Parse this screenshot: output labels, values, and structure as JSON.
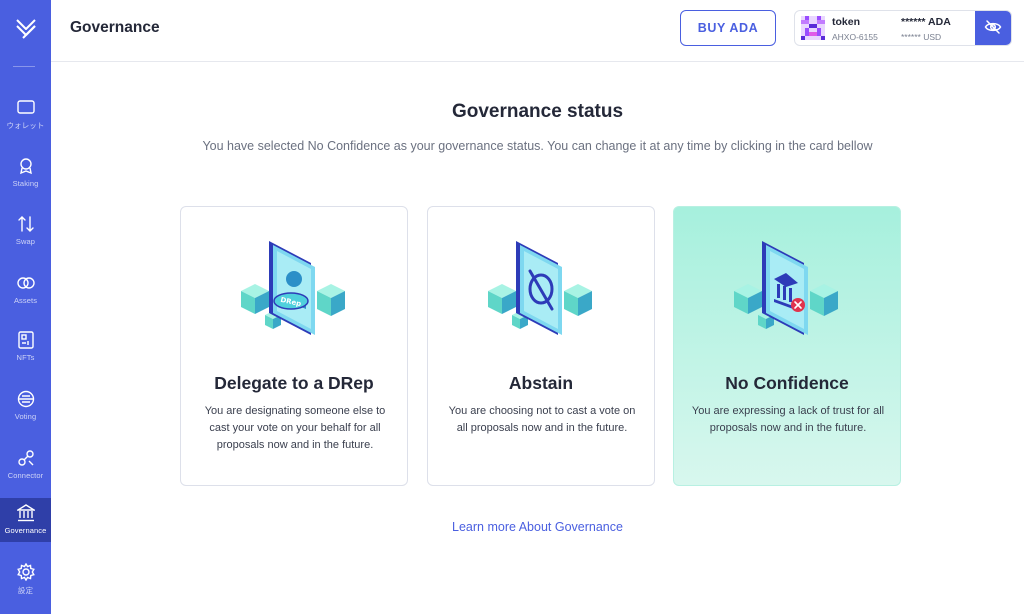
{
  "sidebar": {
    "items": [
      {
        "label": "ウォレット",
        "icon": "wallet-icon"
      },
      {
        "label": "Staking",
        "icon": "staking-icon"
      },
      {
        "label": "Swap",
        "icon": "swap-icon"
      },
      {
        "label": "Assets",
        "icon": "assets-icon"
      },
      {
        "label": "NFTs",
        "icon": "nfts-icon"
      },
      {
        "label": "Voting",
        "icon": "voting-icon"
      },
      {
        "label": "Connector",
        "icon": "connector-icon"
      },
      {
        "label": "Governance",
        "icon": "governance-icon",
        "active": true
      },
      {
        "label": "設定",
        "icon": "settings-icon"
      }
    ]
  },
  "header": {
    "title": "Governance",
    "buy_label": "BUY ADA",
    "wallet": {
      "name": "token",
      "id": "AHXO-6155",
      "ada": "****** ADA",
      "usd": "****** USD"
    }
  },
  "main": {
    "title": "Governance status",
    "subtitle": "You have selected No Confidence as your governance status. You can change it at any time by clicking in the card bellow",
    "cards": [
      {
        "title": "Delegate to a DRep",
        "description": "You are designating someone else to cast your vote on your behalf for all proposals now and in the future.",
        "badge": "DRep"
      },
      {
        "title": "Abstain",
        "description": "You are choosing not to cast a vote on all proposals now and in the future."
      },
      {
        "title": "No Confidence",
        "description": "You are expressing a lack of trust for all proposals now and in the future.",
        "selected": true
      }
    ],
    "learn_more": "Learn more About Governance"
  },
  "colors": {
    "accent": "#4a5fe0",
    "sidebar_active": "#2f3fa8",
    "selected_card": "#a6f0dd"
  }
}
